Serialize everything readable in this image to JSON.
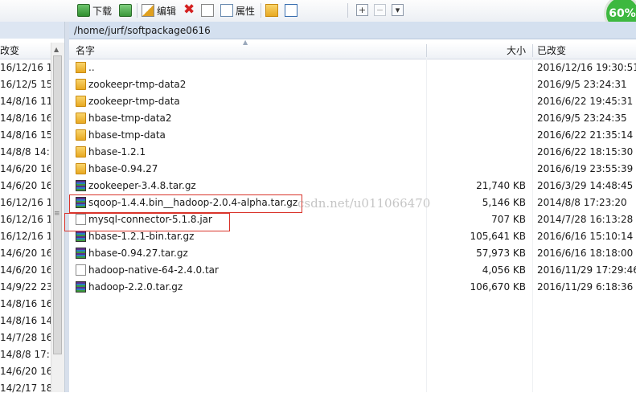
{
  "toolbar": {
    "download_label": "下载",
    "edit_label": "编辑",
    "properties_label": "属性"
  },
  "progress": "60%",
  "left_pane": {
    "column_header": "改变",
    "rows": [
      "16/12/16 1",
      "16/12/5 15",
      "14/8/16 11",
      "14/8/16 16",
      "14/8/16 15",
      "14/8/8 14:",
      "14/6/20 16",
      "14/6/20 16",
      "16/12/16 1",
      "16/12/16 1",
      "16/12/16 1",
      "14/6/20 16",
      "14/6/20 16",
      "14/9/22 23",
      "14/8/16 16",
      "14/8/16 14",
      "14/7/28 16",
      "14/8/8 17:",
      "14/6/20 16",
      "14/2/17 18"
    ]
  },
  "right_pane": {
    "path": "/home/jurf/softpackage0616",
    "columns": {
      "name": "名字",
      "size": "大小",
      "modified": "已改变"
    },
    "files": [
      {
        "icon": "folder-up-icon",
        "name": "..",
        "size": "",
        "date": "2016/12/16 19:30:51"
      },
      {
        "icon": "folder-icon",
        "name": "zookeepr-tmp-data2",
        "size": "",
        "date": "2016/9/5 23:24:31"
      },
      {
        "icon": "folder-icon",
        "name": "zookeepr-tmp-data",
        "size": "",
        "date": "2016/6/22 19:45:31"
      },
      {
        "icon": "folder-icon",
        "name": "hbase-tmp-data2",
        "size": "",
        "date": "2016/9/5 23:24:35"
      },
      {
        "icon": "folder-icon",
        "name": "hbase-tmp-data",
        "size": "",
        "date": "2016/6/22 21:35:14"
      },
      {
        "icon": "folder-icon",
        "name": "hbase-1.2.1",
        "size": "",
        "date": "2016/6/22 18:15:30"
      },
      {
        "icon": "folder-icon",
        "name": "hbase-0.94.27",
        "size": "",
        "date": "2016/6/19 23:55:39"
      },
      {
        "icon": "archive-icon",
        "name": "zookeeper-3.4.8.tar.gz",
        "size": "21,740 KB",
        "date": "2016/3/29 14:48:45"
      },
      {
        "icon": "archive-icon",
        "name": "sqoop-1.4.4.bin__hadoop-2.0.4-alpha.tar.gz",
        "size": "5,146 KB",
        "date": "2014/8/8 17:23:20"
      },
      {
        "icon": "jar-icon",
        "name": "mysql-connector-5.1.8.jar",
        "size": "707 KB",
        "date": "2014/7/28 16:13:28"
      },
      {
        "icon": "archive-icon",
        "name": "hbase-1.2.1-bin.tar.gz",
        "size": "105,641 KB",
        "date": "2016/6/16 15:10:14"
      },
      {
        "icon": "archive-icon",
        "name": "hbase-0.94.27.tar.gz",
        "size": "57,973 KB",
        "date": "2016/6/16 18:18:00"
      },
      {
        "icon": "file-icon",
        "name": "hadoop-native-64-2.4.0.tar",
        "size": "4,056 KB",
        "date": "2016/11/29 17:29:46"
      },
      {
        "icon": "archive-icon",
        "name": "hadoop-2.2.0.tar.gz",
        "size": "106,670 KB",
        "date": "2016/11/29 6:18:36"
      }
    ]
  },
  "watermark": "csdn.net/u011066470"
}
